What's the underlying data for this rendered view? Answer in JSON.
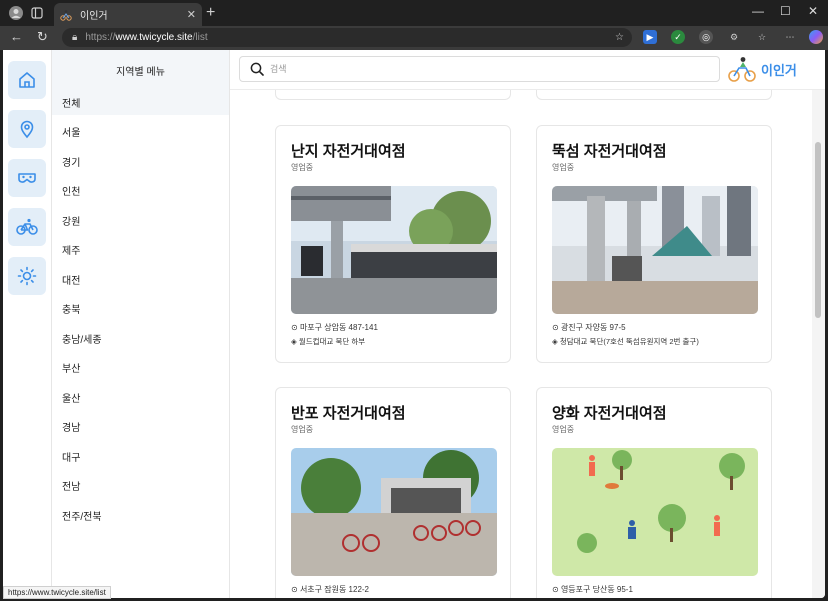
{
  "browser": {
    "tab_title": "이인거",
    "url_scheme": "https://",
    "url_host": "www.twicycle.site",
    "url_path": "/list",
    "status_url": "https://www.twicycle.site/list"
  },
  "search": {
    "placeholder": "검색"
  },
  "brand": {
    "name": "이인거"
  },
  "region_menu": {
    "title": "지역별 메뉴",
    "items": [
      "전체",
      "서울",
      "경기",
      "인천",
      "강원",
      "제주",
      "대전",
      "충북",
      "충남/세종",
      "부산",
      "울산",
      "경남",
      "대구",
      "전남",
      "전주/전북"
    ]
  },
  "cards": [
    {
      "name": "난지 자전거대여점",
      "status": "영업중",
      "address": "마포구 상암동 487-141",
      "desc": "월드컵대교 북단 하부"
    },
    {
      "name": "뚝섬 자전거대여점",
      "status": "영업중",
      "address": "광진구 자양동 97-5",
      "desc": "청담대교 북단(7호선 뚝섬유원지역 2번 출구)"
    },
    {
      "name": "반포 자전거대여점",
      "status": "영업중",
      "address": "서초구 잠원동 122-2",
      "desc": ""
    },
    {
      "name": "양화 자전거대여점",
      "status": "영업중",
      "address": "영등포구 당산동 95-1",
      "desc": ""
    }
  ],
  "colors": {
    "accent": "#3b8ee8",
    "rail_bg": "#e3eef8"
  }
}
